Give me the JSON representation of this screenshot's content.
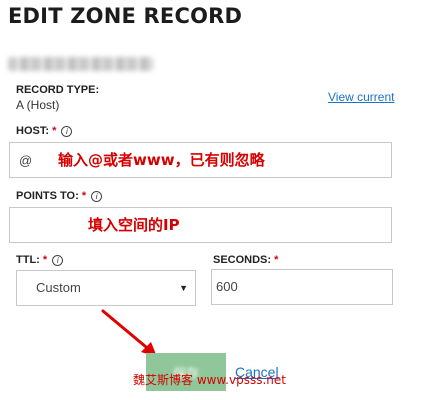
{
  "header": {
    "title": "EDIT ZONE RECORD"
  },
  "record_type": {
    "label": "RECORD TYPE:",
    "value": "A (Host)",
    "link": "View current"
  },
  "host": {
    "label": "HOST:",
    "required": "*",
    "value": "@",
    "annotation": "输入@或者www，已有则忽略"
  },
  "points_to": {
    "label": "POINTS TO:",
    "required": "*",
    "annotation": "填入空间的IP"
  },
  "ttl": {
    "label": "TTL:",
    "required": "*",
    "selected": "Custom"
  },
  "seconds": {
    "label": "SECONDS:",
    "required": "*",
    "value": "600"
  },
  "actions": {
    "save_label": "保存",
    "cancel_label": "Cancel"
  },
  "watermark": "魏艾斯博客 www.vpsss.net",
  "icons": {
    "info": "info-icon",
    "select_caret": "chevron-down-icon",
    "arrow": "red-arrow-annotation"
  },
  "colors": {
    "link": "#1a73c8",
    "annotation": "#d60000",
    "save_button": "#8fc79a",
    "required": "#d0021b"
  }
}
